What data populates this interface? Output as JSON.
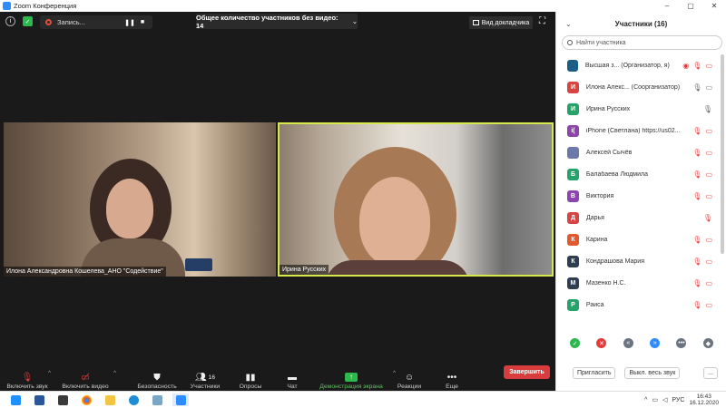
{
  "window": {
    "title": "Zoom Конференция",
    "controls": [
      "–",
      "▢",
      "✕"
    ]
  },
  "topbar": {
    "recording_label": "Запись...",
    "banner": "Общее количество участников без видео: 14",
    "view_button": "Вид докладчика"
  },
  "videos": [
    {
      "name": "Илона Александровна Кошелева_АНО \"Содействие\""
    },
    {
      "name": "Ирина Русских"
    }
  ],
  "toolbar": {
    "audio": "Включить звук",
    "video": "Включить видео",
    "security": "Безопасность",
    "participants": "Участники",
    "participants_count": "16",
    "polls": "Опросы",
    "chat": "Чат",
    "share": "Демонстрация экрана",
    "reactions": "Реакции",
    "more": "Еще",
    "end": "Завершить"
  },
  "panel": {
    "title": "Участники (16)",
    "search_placeholder": "Найти участника",
    "participants": [
      {
        "initial": "",
        "name": "Высшая з... (Организатор, я)",
        "color": "#1b5f86",
        "mic": "muted",
        "cam": "off",
        "rec": true
      },
      {
        "initial": "И",
        "name": "Илона Алекс... (Соорганизатор)",
        "color": "#d64541",
        "mic": "on",
        "cam": "on"
      },
      {
        "initial": "И",
        "name": "Ирина Русских",
        "color": "#27a36a",
        "mic": "on",
        "cam": "none"
      },
      {
        "initial": "i(",
        "name": "iPhone (Светлана) https://us02...",
        "color": "#8e44ad",
        "mic": "muted",
        "cam": "off"
      },
      {
        "initial": "",
        "name": "Алексей Сычёв",
        "color": "#6b7aa8",
        "mic": "muted",
        "cam": "off"
      },
      {
        "initial": "Б",
        "name": "Балабаева Людмила",
        "color": "#27a36a",
        "mic": "muted",
        "cam": "off"
      },
      {
        "initial": "В",
        "name": "Виктория",
        "color": "#8e44ad",
        "mic": "muted",
        "cam": "off"
      },
      {
        "initial": "Д",
        "name": "Дарья",
        "color": "#d64541",
        "mic": "muted",
        "cam": "none"
      },
      {
        "initial": "К",
        "name": "Карина",
        "color": "#e2582f",
        "mic": "muted",
        "cam": "off"
      },
      {
        "initial": "К",
        "name": "Кондрашова Мария",
        "color": "#2c3e50",
        "mic": "muted",
        "cam": "off"
      },
      {
        "initial": "М",
        "name": "Мазенко Н.С.",
        "color": "#2c3e50",
        "mic": "muted",
        "cam": "off"
      },
      {
        "initial": "Р",
        "name": "Раиса",
        "color": "#27a36a",
        "mic": "muted",
        "cam": "off"
      }
    ],
    "reactions": [
      {
        "symbol": "✓",
        "color": "#2db84d"
      },
      {
        "symbol": "✕",
        "color": "#e03c3c"
      },
      {
        "symbol": "«",
        "color": "#6b7280"
      },
      {
        "symbol": "»",
        "color": "#2d8cff"
      },
      {
        "symbol": "•••",
        "color": "#6b7280"
      },
      {
        "symbol": "◆",
        "color": "#6b7280"
      }
    ],
    "invite": "Пригласить",
    "mute_all": "Выкл. весь звук",
    "more": "..."
  },
  "taskbar": {
    "lang": "РУС",
    "time": "16:43",
    "date": "16.12.2020"
  }
}
